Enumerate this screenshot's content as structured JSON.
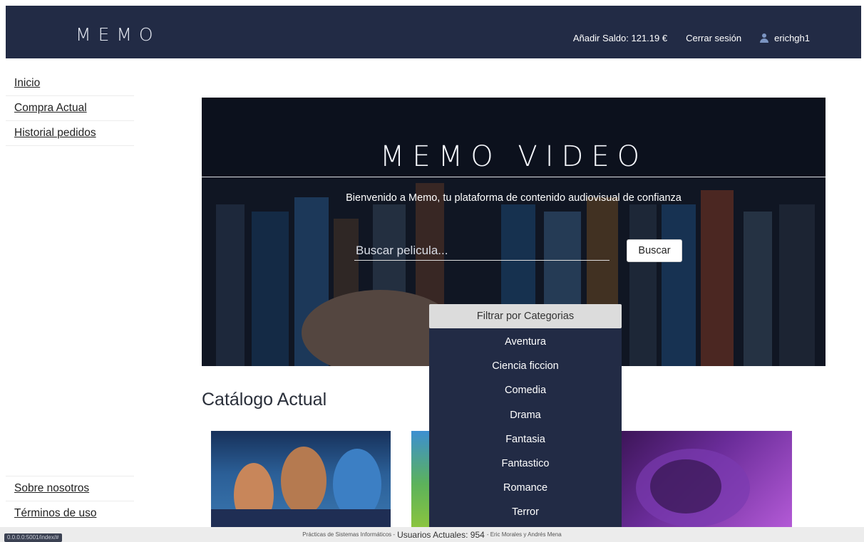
{
  "header": {
    "logo": "MEMO",
    "add_balance": "Añadir Saldo: 121.19 €",
    "logout": "Cerrar sesión",
    "username": "erichgh1"
  },
  "sidebar": {
    "items": [
      {
        "label": "Inicio"
      },
      {
        "label": "Compra Actual"
      },
      {
        "label": "Historial pedidos"
      }
    ],
    "bottom_items": [
      {
        "label": "Sobre nosotros"
      },
      {
        "label": "Términos de uso"
      }
    ]
  },
  "hero": {
    "title": "MEMO VIDEO",
    "subtitle": "Bienvenido a Memo, tu plataforma de contenido audiovisual de confianza",
    "search_placeholder": "Buscar pelicula...",
    "search_button": "Buscar"
  },
  "filter": {
    "header": "Filtrar por Categorias",
    "options": [
      "Aventura",
      "Ciencia ficcion",
      "Comedia",
      "Drama",
      "Fantasia",
      "Fantastico",
      "Romance",
      "Terror"
    ]
  },
  "catalog": {
    "title": "Catálogo Actual"
  },
  "footer": {
    "left": "Prácticas de Sistemas Informáticos -",
    "users": "Usuarios Actuales: 954",
    "right": "- Eric Morales y Andrés Mena"
  },
  "status_url": "0.0.0.0:5001/index/#",
  "colors": {
    "navbar": "#222b45",
    "dropdown_bg": "#222b45",
    "dropdown_header": "#dcdcdc"
  }
}
